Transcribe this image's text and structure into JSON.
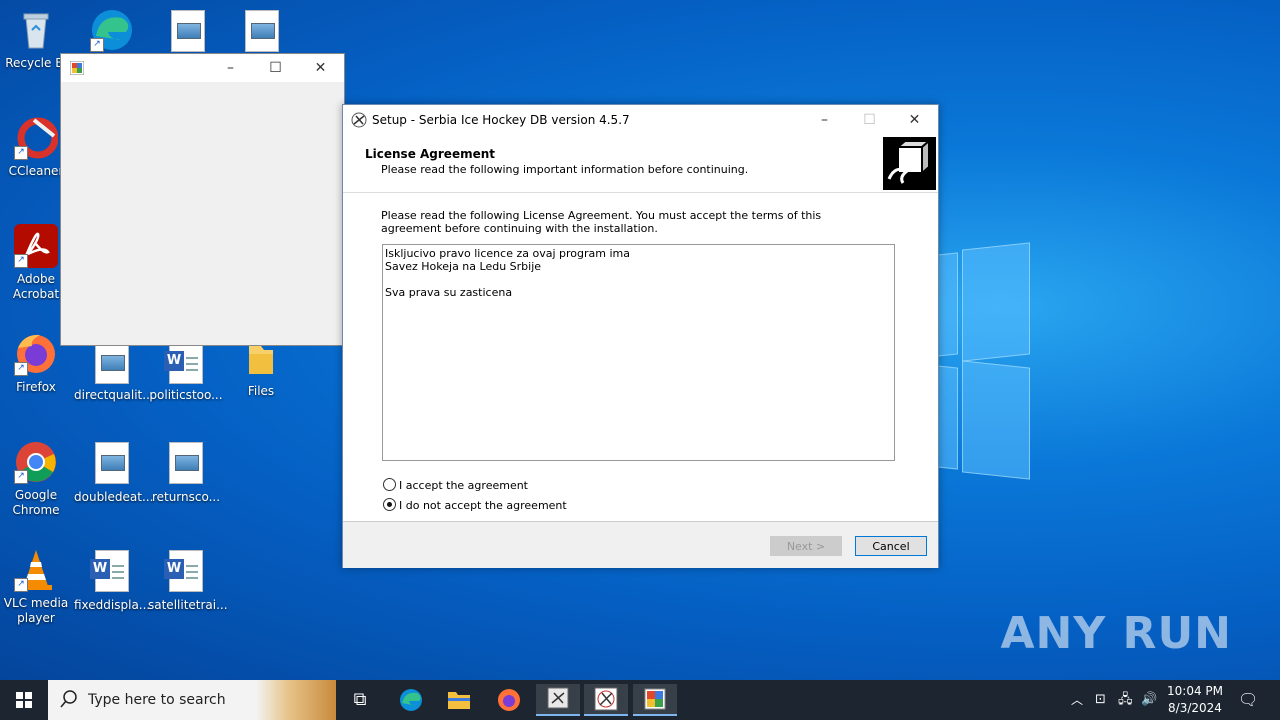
{
  "desktop": {
    "icons": [
      {
        "label": "Recycle Bin",
        "display": "Recycle Bi"
      },
      {
        "label": "CCleaner"
      },
      {
        "label": "Adobe Acrobat"
      },
      {
        "label": "Firefox"
      },
      {
        "label": "Google Chrome"
      },
      {
        "label": "VLC media player"
      },
      {
        "label": "directqualit..."
      },
      {
        "label": "politicstoo..."
      },
      {
        "label": "Files"
      },
      {
        "label": "doubledeat..."
      },
      {
        "label": "returnsco..."
      },
      {
        "label": "fixeddispla..."
      },
      {
        "label": "satellitetrai..."
      }
    ],
    "watermark": "ANY RUN"
  },
  "setup_window": {
    "title": "Setup - Serbia Ice Hockey DB version 4.5.7",
    "header_title": "License Agreement",
    "header_subtitle": "Please read the following important information before continuing.",
    "intro": "Please read the following License Agreement. You must accept the terms of this agreement before continuing with the installation.",
    "license_lines": [
      "Iskljucivo pravo licence za ovaj program ima",
      "Savez Hokeja na Ledu Srbije",
      "",
      "Sva prava su zasticena"
    ],
    "accept_label": "I accept the agreement",
    "decline_label": "I do not accept the agreement",
    "selected": "decline",
    "next_label": "Next >",
    "cancel_label": "Cancel"
  },
  "taskbar": {
    "search_placeholder": "Type here to search",
    "time": "10:04 PM",
    "date": "8/3/2024"
  }
}
